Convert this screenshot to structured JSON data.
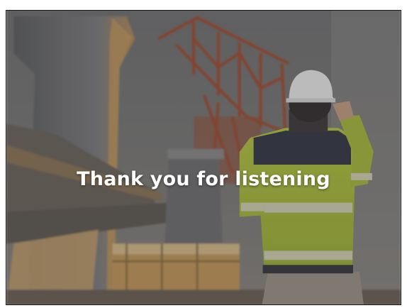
{
  "slide": {
    "title": "Thank you for listening",
    "background": "construction-site-photo",
    "overlay_color": "#3a3a3a",
    "text_color": "#ffffff"
  }
}
